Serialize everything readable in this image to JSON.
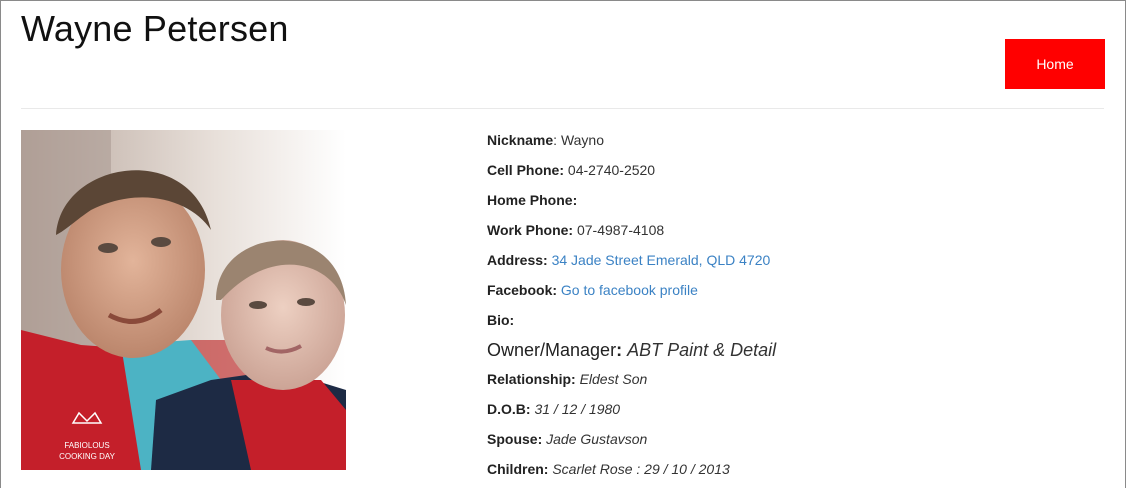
{
  "header": {
    "title": "Wayne Petersen",
    "home_label": "Home"
  },
  "photo": {
    "apron_text_line1": "FABIOLOUS",
    "apron_text_line2": "COOKING DAY"
  },
  "profile": {
    "nickname": {
      "label": "Nickname",
      "value": "Wayno"
    },
    "cell_phone": {
      "label": "Cell Phone:",
      "value": "04-2740-2520"
    },
    "home_phone": {
      "label": "Home Phone:",
      "value": ""
    },
    "work_phone": {
      "label": "Work Phone:",
      "value": "07-4987-4108"
    },
    "address": {
      "label": "Address:",
      "value": "34 Jade Street Emerald, QLD 4720"
    },
    "facebook": {
      "label": "Facebook:",
      "value": "Go to facebook profile"
    },
    "bio": {
      "label": "Bio:"
    },
    "role": {
      "label": "Owner/Manager",
      "value": "ABT Paint & Detail"
    },
    "relationship": {
      "label": "Relationship:",
      "value": "Eldest Son"
    },
    "dob": {
      "label": "D.O.B:",
      "value": "31 / 12 / 1980"
    },
    "spouse": {
      "label": "Spouse:",
      "value": "Jade Gustavson"
    },
    "children": {
      "label": "Children:",
      "value": "Scarlet Rose : 29 / 10 / 2013"
    }
  },
  "colors": {
    "accent": "#ff0000",
    "link": "#3b82c4"
  }
}
